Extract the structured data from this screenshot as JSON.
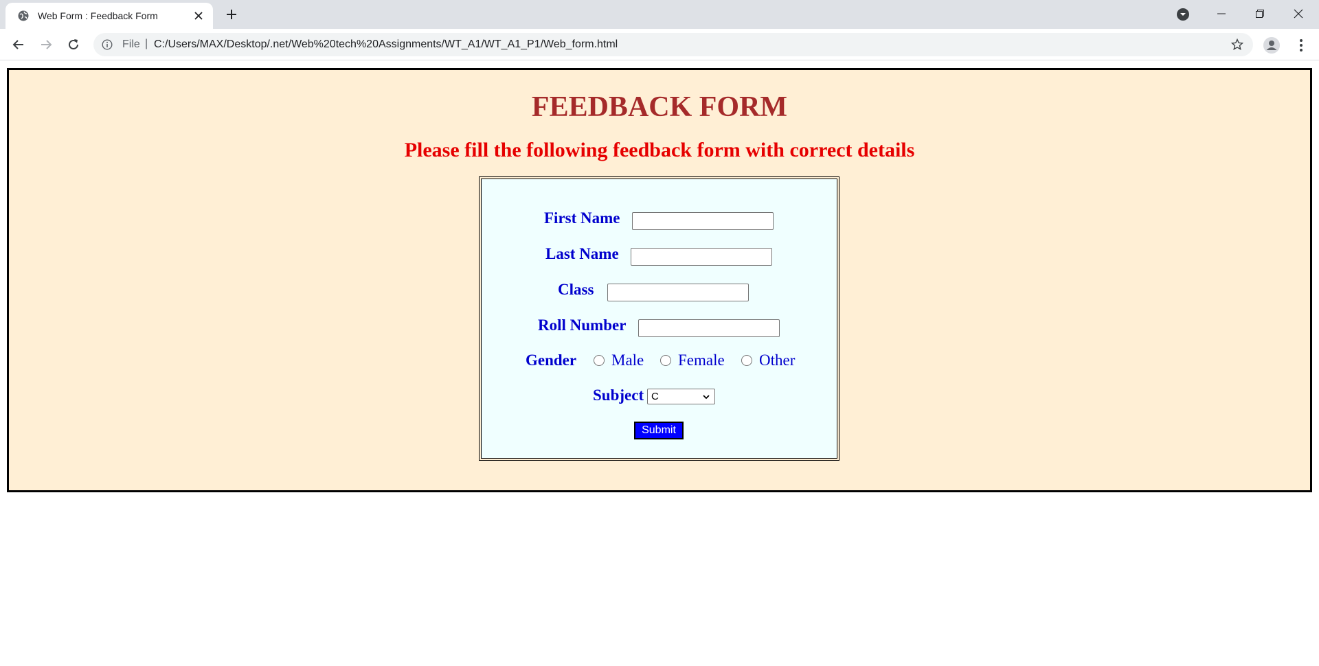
{
  "browser": {
    "tab_title": "Web Form : Feedback Form",
    "file_label": "File",
    "url": "C:/Users/MAX/Desktop/.net/Web%20tech%20Assignments/WT_A1/WT_A1_P1/Web_form.html"
  },
  "page": {
    "title": "FEEDBACK FORM",
    "subtitle": "Please fill the following feedback form with correct details",
    "colors": {
      "page_bg": "#ffefd5",
      "form_bg": "#f0ffff",
      "title": "#a52a2a",
      "subtitle": "#e60000",
      "label": "#0000cd",
      "submit_bg": "#0000ff"
    },
    "form": {
      "first_name_label": "First Name",
      "first_name_value": "",
      "last_name_label": "Last Name",
      "last_name_value": "",
      "class_label": "Class",
      "class_value": "",
      "roll_label": "Roll Number",
      "roll_value": "",
      "gender_label": "Gender",
      "gender_options": [
        "Male",
        "Female",
        "Other"
      ],
      "subject_label": "Subject",
      "subject_selected": "C",
      "submit_label": "Submit"
    }
  }
}
